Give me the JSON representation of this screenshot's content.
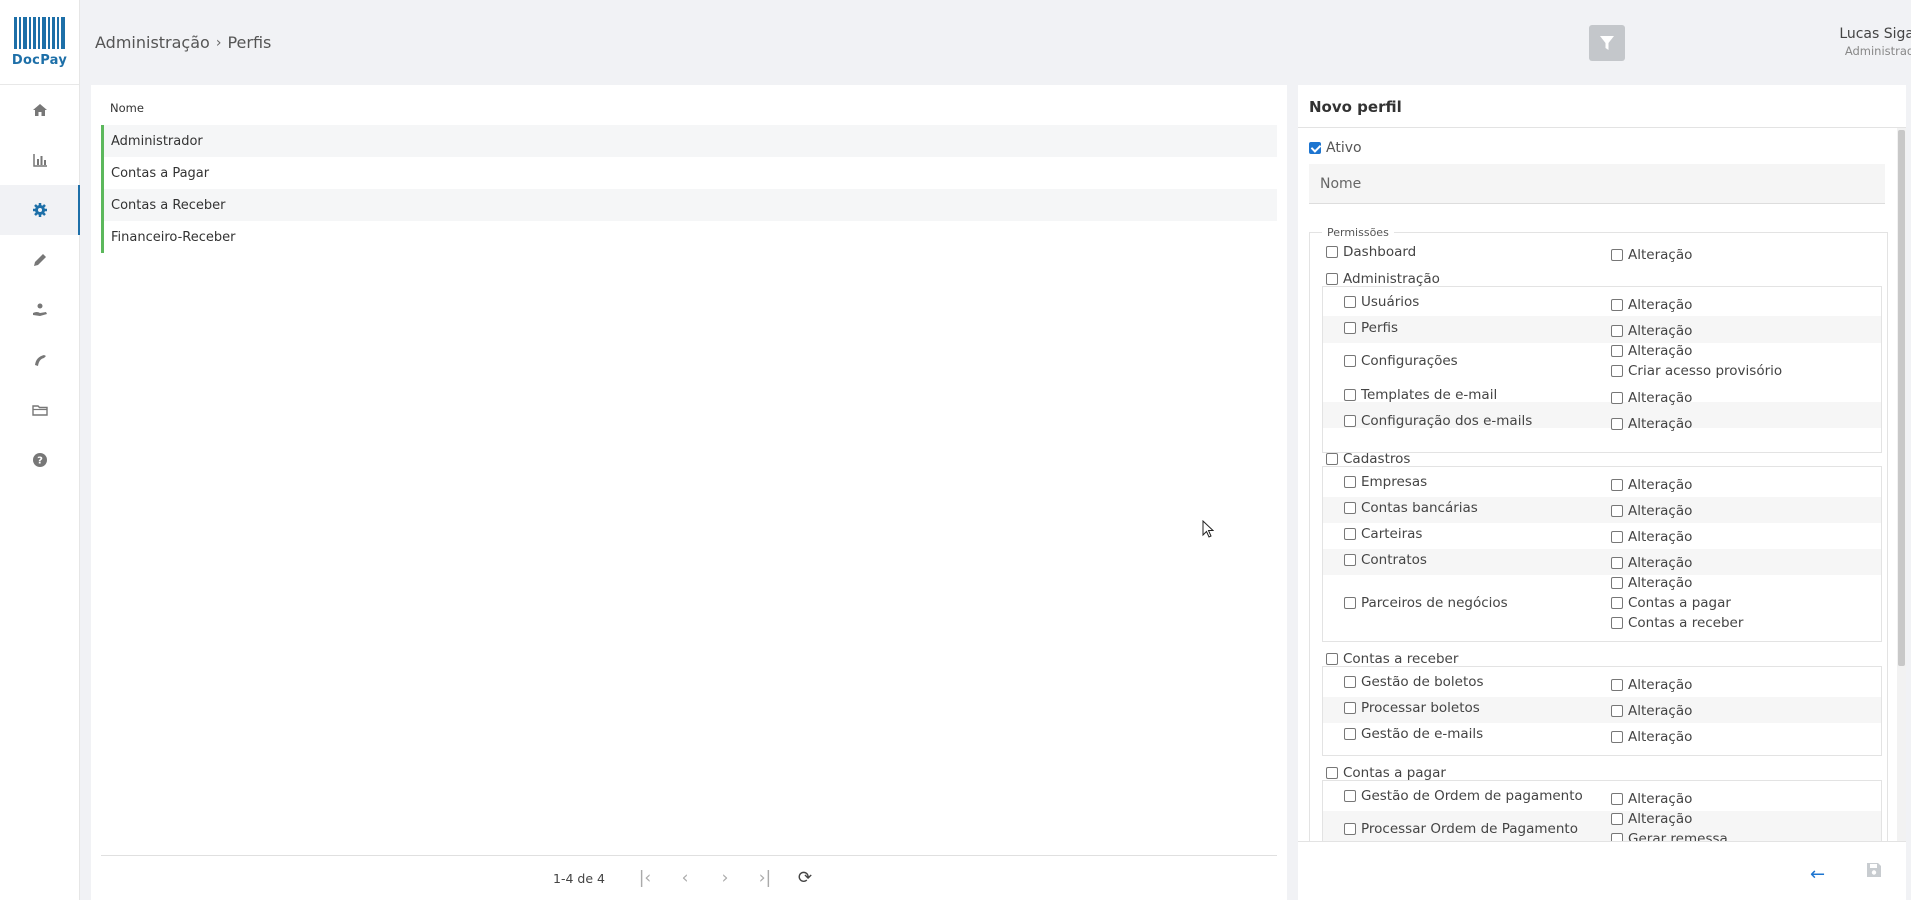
{
  "sidebar": {
    "logo_text": "DocPay",
    "items": [
      {
        "icon": "home-icon"
      },
      {
        "icon": "bar-chart-icon"
      },
      {
        "icon": "gear-icon",
        "active": true
      },
      {
        "icon": "pencil-icon"
      },
      {
        "icon": "hand-coin-icon"
      },
      {
        "icon": "hand-receive-icon"
      },
      {
        "icon": "folder-icon"
      },
      {
        "icon": "help-icon"
      }
    ]
  },
  "header": {
    "breadcrumb_parent": "Administração",
    "breadcrumb_sep": "›",
    "breadcrumb_current": "Perfis",
    "user_name": "Lucas Sigaki",
    "user_role": "Administrador"
  },
  "list": {
    "column_header": "Nome",
    "rows": [
      "Administrador",
      "Contas a Pagar",
      "Contas a Receber",
      "Financeiro-Receber"
    ],
    "pagination_info": "1-4 de 4",
    "row_accent_color": "#5cb85c"
  },
  "form": {
    "title": "Novo perfil",
    "ativo_label": "Ativo",
    "ativo_checked": true,
    "nome_placeholder": "Nome",
    "permissions_legend": "Permissões",
    "dashboard": {
      "label": "Dashboard",
      "right": [
        "Alteração"
      ]
    },
    "administracao": {
      "label": "Administração",
      "items": [
        {
          "label": "Usuários",
          "right": [
            "Alteração"
          ]
        },
        {
          "label": "Perfis",
          "right": [
            "Alteração"
          ]
        },
        {
          "label": "Configurações",
          "right": [
            "Alteração",
            "Criar acesso provisório"
          ]
        },
        {
          "label": "Templates de e-mail",
          "right": [
            "Alteração"
          ]
        },
        {
          "label": "Configuração dos e-mails",
          "right": [
            "Alteração"
          ]
        }
      ]
    },
    "cadastros": {
      "label": "Cadastros",
      "items": [
        {
          "label": "Empresas",
          "right": [
            "Alteração"
          ]
        },
        {
          "label": "Contas bancárias",
          "right": [
            "Alteração"
          ]
        },
        {
          "label": "Carteiras",
          "right": [
            "Alteração"
          ]
        },
        {
          "label": "Contratos",
          "right": [
            "Alteração"
          ]
        },
        {
          "label": "Parceiros de negócios",
          "right": [
            "Alteração",
            "Contas a pagar",
            "Contas a receber"
          ]
        }
      ]
    },
    "contas_receber": {
      "label": "Contas a receber",
      "items": [
        {
          "label": "Gestão de boletos",
          "right": [
            "Alteração"
          ]
        },
        {
          "label": "Processar boletos",
          "right": [
            "Alteração"
          ]
        },
        {
          "label": "Gestão de e-mails",
          "right": [
            "Alteração"
          ]
        }
      ]
    },
    "contas_pagar": {
      "label": "Contas a pagar",
      "items": [
        {
          "label": "Gestão de Ordem de pagamento",
          "right": [
            "Alteração"
          ]
        },
        {
          "label": "Processar Ordem de Pagamento",
          "right": [
            "Alteração",
            "Gerar remessa"
          ]
        }
      ]
    }
  },
  "colors": {
    "brand": "#1d6fa8",
    "accent_blue": "#1d75d0",
    "filter_button": "#c4c7cb"
  }
}
